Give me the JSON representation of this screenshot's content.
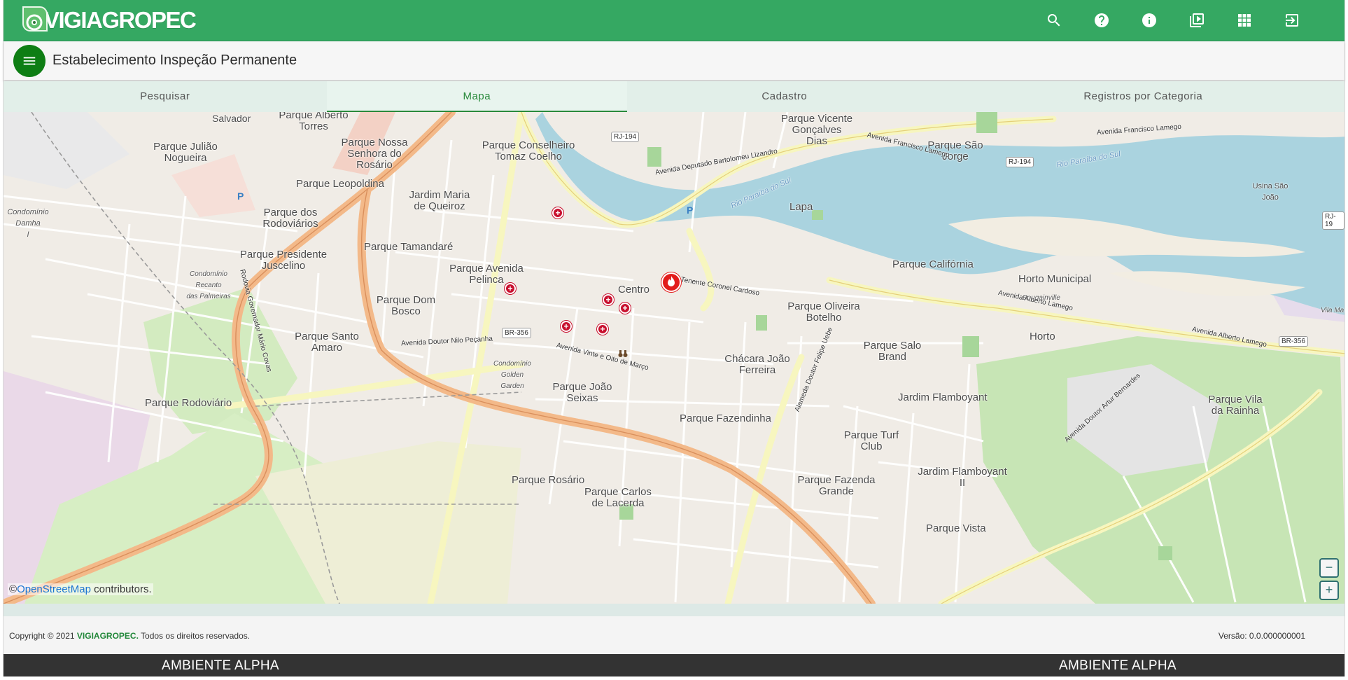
{
  "header": {
    "brand": "VIGIAGROPEC",
    "icons": [
      "search-icon",
      "help-icon",
      "info-icon",
      "video-library-icon",
      "apps-grid-icon",
      "logout-icon"
    ]
  },
  "titlebar": {
    "title": "Estabelecimento Inspeção Permanente"
  },
  "tabs": [
    {
      "label": "Pesquisar"
    },
    {
      "label": "Mapa"
    },
    {
      "label": "Cadastro"
    },
    {
      "label": "Registros por Categoria"
    }
  ],
  "map": {
    "labels": {
      "salvador": "Salvador",
      "parque_alberto_torres": "Parque Alberto\nTorres",
      "parque_juliao_nogueira": "Parque Julião\nNogueira",
      "parque_nossa_senhora_rosario": "Parque Nossa\nSenhora do\nRosário",
      "parque_conselheiro": "Parque Conselheiro\nTomaz Coelho",
      "parque_vicente": "Parque Vicente\nGonçalves\nDias",
      "parque_sao_jorge": "Parque São\nJorge",
      "usina_sao_joao": "Usina São\nJoão",
      "parque_leopoldina": "Parque Leopoldina",
      "jardim_maria_queiroz": "Jardim Maria\nde Queiroz",
      "condominio_damha": "Condomínio\nDamha\nI",
      "parque_rodoviarios": "Parque dos\nRodoviários",
      "lapa": "Lapa",
      "parque_tamandare": "Parque Tamandaré",
      "parque_presidente_juscelino": "Parque Presidente\nJuscelino",
      "parque_avenida_pelinca": "Parque Avenida\nPelinca",
      "parque_california": "Parque Califórnia",
      "horto_municipal": "Horto Municipal",
      "centro": "Centro",
      "parque_dom_bosco": "Parque Dom\nBosco",
      "parque_oliveira_botelho": "Parque Oliveira\nBotelho",
      "horto": "Horto",
      "parque_santo_amaro": "Parque Santo\nAmaro",
      "parque_salo_brand": "Parque Salo\nBrand",
      "chacara_joao_ferreira": "Chácara João\nFerreira",
      "parque_joao_seixas": "Parque João\nSeixas",
      "jardim_flamboyant": "Jardim Flamboyant",
      "parque_vila_rainha": "Parque Vila\nda Rainha",
      "parque_rodoviario": "Parque Rodoviário",
      "parque_fazendinha": "Parque Fazendinha",
      "parque_turf_club": "Parque Turf\nClub",
      "jardim_flamboyant_ii": "Jardim Flamboyant\nII",
      "parque_rosario": "Parque Rosário",
      "parque_carlos_lacerda": "Parque Carlos\nde Lacerda",
      "parque_fazenda_grande": "Parque Fazenda\nGrande",
      "parque_vista": "Parque Vista",
      "rio_paraiba_1": "Rio Paraíba do Sul",
      "rio_paraiba_2": "Rio Paraíba do Sul",
      "av_deputado": "Avenida Deputado Bartolomeu Lizandro",
      "av_francisco_lamego": "Avenida Francisco Lamego",
      "av_alberto_lamego": "Avenida Alberto Lamego",
      "av_nilo_pecanha": "Avenida Doutor Nilo Peçanha",
      "av_vinte_oito_marco": "Avenida Vinte e Oito de Março",
      "rua_tenente_coronel": "Rua Tenente Coronel Cardoso",
      "av_artur_bernardes": "Avenida Doutor Artur Bernardes",
      "alameda_felipe_uebe": "Alameda Doutor Felipe Uebe",
      "rodovia_mario_covas": "Rodovia Governador Mário Covas",
      "cond_recanto": "Condomínio\nRecanto\ndas Palmeiras",
      "cond_golden": "Condomínio\nGolden\nGarden",
      "bougainville": "Bougainville",
      "vila_ma": "Vila Ma"
    },
    "shields": [
      "RJ-194",
      "RJ-194",
      "BR-356",
      "BR-356",
      "RJ-19"
    ],
    "parking_symbol": "P",
    "attribution_prefix": "©",
    "attribution_link": "OpenStreetMap",
    "attribution_suffix": " contributors.",
    "zoom_out": "−",
    "zoom_in": "+"
  },
  "footer": {
    "copyright_prefix": "Copyright © 2021 ",
    "copyright_brand": "VIGIAGROPEC.",
    "copyright_suffix": " Todos os direitos reservados.",
    "version": "Versão: 0.0.000000001"
  },
  "environment": {
    "left": "AMBIENTE ALPHA",
    "right": "AMBIENTE ALPHA"
  },
  "colors": {
    "header": "#35a862",
    "menu_button": "#0e7e14",
    "active_tab": "#2a8a3c",
    "marker": "#c8102e",
    "env_bar": "#333333"
  }
}
